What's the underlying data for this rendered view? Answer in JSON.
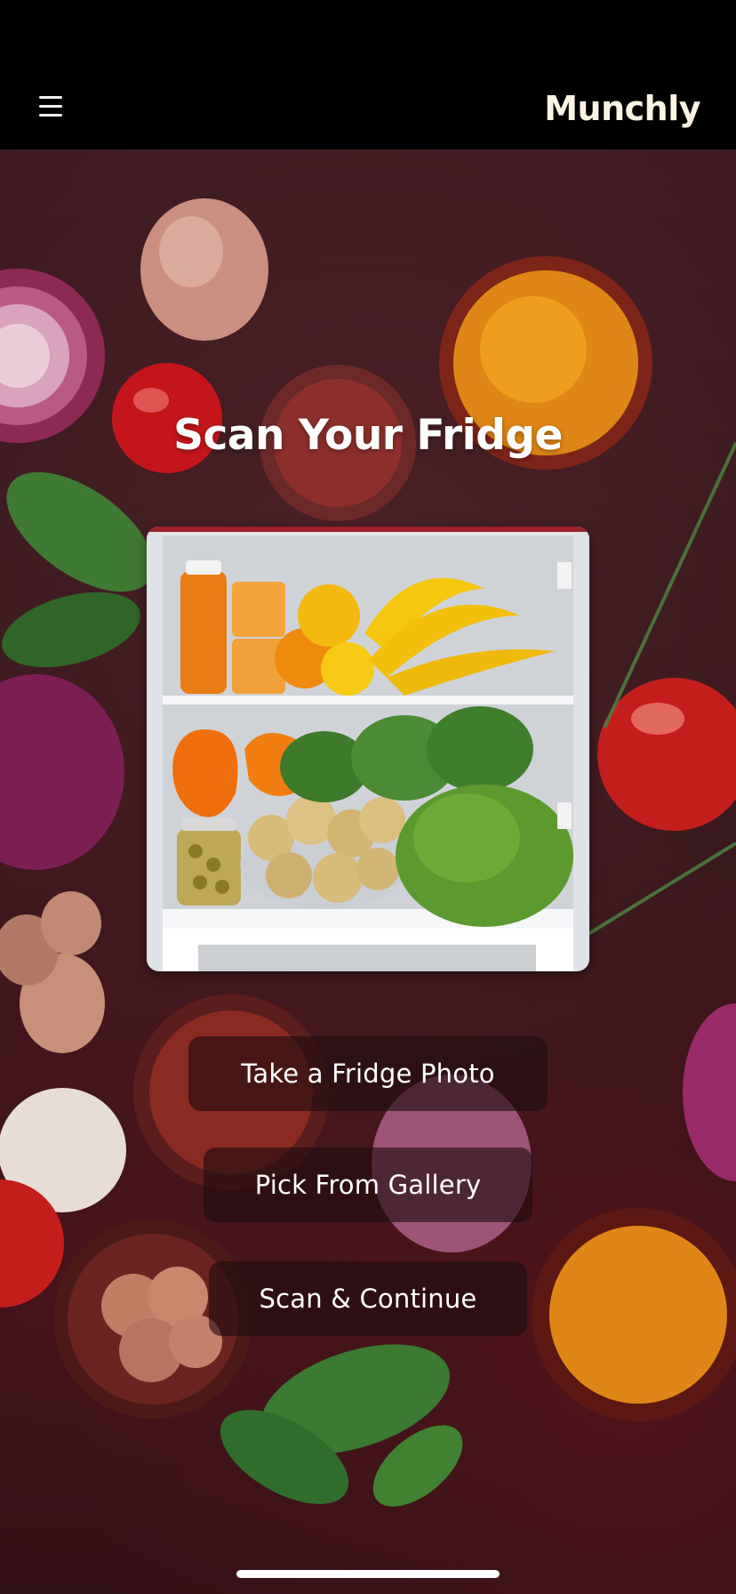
{
  "header": {
    "brand": "Munchly",
    "menu_icon": "hamburger-menu-icon"
  },
  "main": {
    "title": "Scan Your Fridge",
    "image_alt": "fridge-contents-image"
  },
  "actions": {
    "take_photo_label": "Take a Fridge Photo",
    "gallery_label": "Pick From Gallery",
    "scan_label": "Scan & Continue"
  },
  "colors": {
    "topbar": "#000000",
    "brand_text": "#fbf3e3",
    "background": "#3a1a1e",
    "button_bg": "rgba(30,12,15,0.62)"
  }
}
